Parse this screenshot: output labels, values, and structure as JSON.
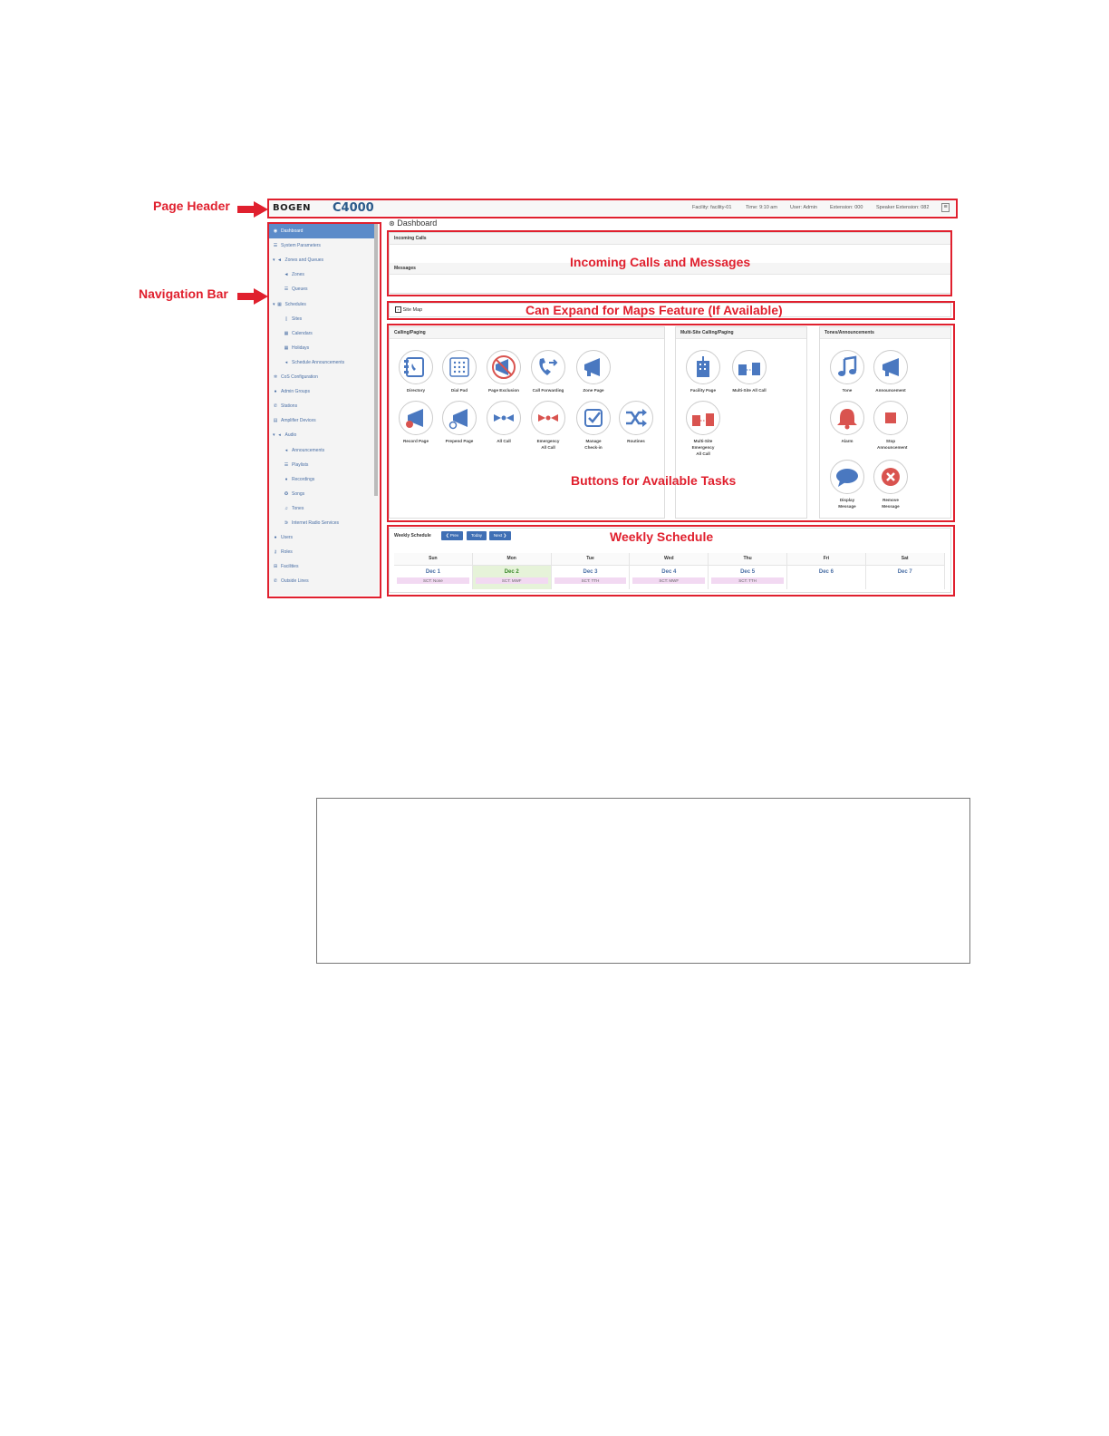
{
  "callouts": {
    "page_header": "Page Header",
    "navigation_bar": "Navigation Bar",
    "incoming": "Incoming Calls and Messages",
    "maps": "Can Expand for Maps Feature (If Available)",
    "buttons": "Buttons for Available Tasks",
    "weekly": "Weekly Schedule"
  },
  "header": {
    "logo": "BOGEN",
    "product": "C4000",
    "facility": "Facility: facility-01",
    "time": "Time: 9:10 am",
    "user": "User: Admin",
    "extension": "Extension: 000",
    "speaker_extension": "Speaker Extension: 082"
  },
  "nav": {
    "items": [
      {
        "label": "Dashboard",
        "icon": "dashboard-icon"
      },
      {
        "label": "System Parameters",
        "icon": "list-icon"
      },
      {
        "label": "Zones and Queues",
        "icon": "megaphone-icon"
      },
      {
        "label": "Zones",
        "icon": "megaphone-icon"
      },
      {
        "label": "Queues",
        "icon": "list-icon"
      },
      {
        "label": "Schedules",
        "icon": "calendar-icon"
      },
      {
        "label": "Sites",
        "icon": "building-icon"
      },
      {
        "label": "Calendars",
        "icon": "calendar-icon"
      },
      {
        "label": "Holidays",
        "icon": "calendar-icon"
      },
      {
        "label": "Schedule Announcements",
        "icon": "speaker-icon"
      },
      {
        "label": "CoS Configuration",
        "icon": "cogs-icon"
      },
      {
        "label": "Admin Groups",
        "icon": "group-icon"
      },
      {
        "label": "Stations",
        "icon": "phone-icon"
      },
      {
        "label": "Amplifier Devices",
        "icon": "amplifier-icon"
      },
      {
        "label": "Audio",
        "icon": "speaker-icon"
      },
      {
        "label": "Announcements",
        "icon": "speaker-icon"
      },
      {
        "label": "Playlists",
        "icon": "list-icon"
      },
      {
        "label": "Recordings",
        "icon": "microphone-icon"
      },
      {
        "label": "Songs",
        "icon": "disc-icon"
      },
      {
        "label": "Tones",
        "icon": "music-icon"
      },
      {
        "label": "Internet Radio Services",
        "icon": "rss-icon"
      },
      {
        "label": "Users",
        "icon": "user-icon"
      },
      {
        "label": "Roles",
        "icon": "key-icon"
      },
      {
        "label": "Facilities",
        "icon": "sitemap-icon"
      },
      {
        "label": "Outside Lines",
        "icon": "phone-icon"
      }
    ]
  },
  "main": {
    "title": "Dashboard",
    "incoming_calls": "Incoming Calls",
    "messages": "Messages",
    "site_map": "Site Map",
    "calling_paging": "Calling/Paging",
    "multi_site": "Multi-Site Calling/Paging",
    "tones_announcements": "Tones/Announcements"
  },
  "tiles": {
    "calling": [
      {
        "label": "Directory",
        "icon": "directory-icon"
      },
      {
        "label": "Dial Pad",
        "icon": "dialpad-icon"
      },
      {
        "label": "Page Exclusion",
        "icon": "page-exclusion-icon"
      },
      {
        "label": "Call Forwarding",
        "icon": "call-forwarding-icon"
      },
      {
        "label": "Zone Page",
        "icon": "megaphone-icon"
      },
      {
        "label": "Record Page",
        "icon": "record-page-icon"
      },
      {
        "label": "Prepend Page",
        "icon": "prepend-page-icon"
      },
      {
        "label": "All Call",
        "icon": "all-call-icon"
      },
      {
        "label": "Emergency All Call",
        "icon": "emergency-all-call-icon"
      },
      {
        "label": "Manage Check-in",
        "icon": "checkbox-icon"
      },
      {
        "label": "Routines",
        "icon": "shuffle-icon"
      }
    ],
    "multisite": [
      {
        "label": "Facility Page",
        "icon": "building-icon"
      },
      {
        "label": "Multi-Site All Call",
        "icon": "multi-building-icon"
      },
      {
        "label": "Multi-Site Emergency All Call",
        "icon": "multi-building-emergency-icon"
      }
    ],
    "tones": [
      {
        "label": "Tone",
        "icon": "music-note-icon"
      },
      {
        "label": "Announcement",
        "icon": "announcement-icon"
      },
      {
        "label": "Alarm",
        "icon": "bell-icon"
      },
      {
        "label": "Stop Announcement",
        "icon": "stop-icon"
      },
      {
        "label": "Display Message",
        "icon": "chat-bubble-icon"
      },
      {
        "label": "Remove Message",
        "icon": "close-circle-icon"
      }
    ]
  },
  "schedule": {
    "title": "Weekly Schedule",
    "prev": "❮ Prev",
    "today": "Today",
    "next": "Next ❯",
    "days": [
      {
        "name": "Sun",
        "date": "Dec 1",
        "event": "SCT: None"
      },
      {
        "name": "Mon",
        "date": "Dec 2",
        "event": "SCT: MWF"
      },
      {
        "name": "Tue",
        "date": "Dec 3",
        "event": "SCT: TTH"
      },
      {
        "name": "Wed",
        "date": "Dec 4",
        "event": "SCT: MWF"
      },
      {
        "name": "Thu",
        "date": "Dec 5",
        "event": "SCT: TTH"
      },
      {
        "name": "Fri",
        "date": "Dec 6",
        "event": ""
      },
      {
        "name": "Sat",
        "date": "Dec 7",
        "event": ""
      }
    ]
  },
  "colors": {
    "callout": "#e0202e",
    "accent": "#3f6fb5",
    "icon_blue": "#4a78c0",
    "icon_red": "#d9534f",
    "today": "#e6f3d9"
  }
}
